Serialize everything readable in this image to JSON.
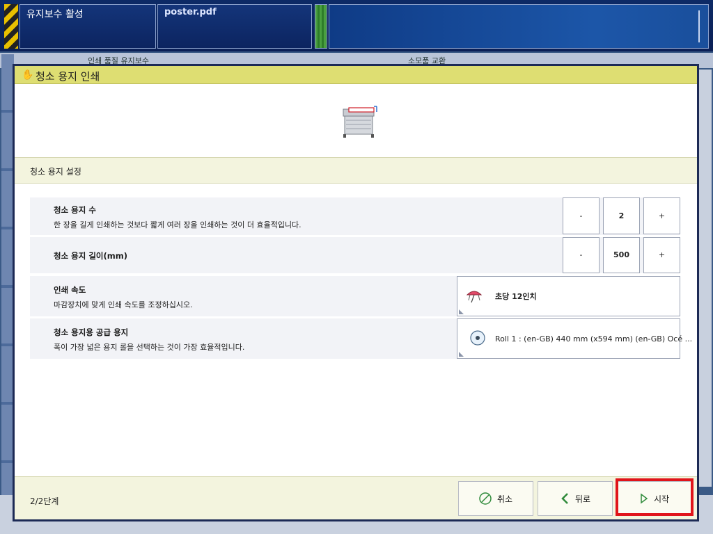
{
  "topbar": {
    "mode": "유지보수 활성",
    "job": "poster.pdf"
  },
  "background": {
    "tab_left": "인쇄 품질 유지보수",
    "tab_right": "소모품 교환"
  },
  "dialog": {
    "title": "청소 용지 인쇄",
    "section": "청소 용지 설정",
    "rows": {
      "count": {
        "name": "청소 용지 수",
        "desc": "한 장을 길게 인쇄하는 것보다 짧게 여러 장을 인쇄하는 것이 더 효율적입니다.",
        "minus": "-",
        "value": "2",
        "plus": "+"
      },
      "length": {
        "name": "청소 용지 길이(mm)",
        "minus": "-",
        "value": "500",
        "plus": "+"
      },
      "speed": {
        "name": "인쇄 속도",
        "desc": "마감장치에 맞게 인쇄 속도를 조정하십시오.",
        "value": "초당 12인치"
      },
      "media": {
        "name": "청소 용지용 공급 용지",
        "desc": "폭이 가장 넓은 용지 롤을 선택하는 것이 가장 효율적입니다.",
        "value": "Roll 1 : (en-GB) 440 mm (x594 mm) (en-GB) Océ ..."
      }
    },
    "footer": {
      "step": "2/2단계",
      "cancel": "취소",
      "back": "뒤로",
      "start": "시작"
    }
  },
  "colors": {
    "title_bar": "#dede72",
    "section_bg": "#f3f4de",
    "row_bg": "#f2f3f7",
    "highlight": "#e0141a"
  }
}
